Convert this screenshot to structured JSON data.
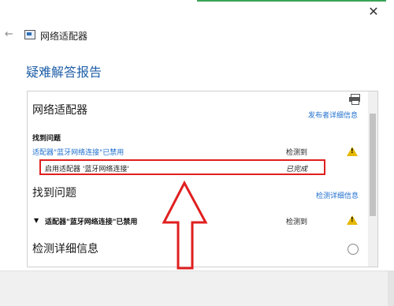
{
  "window": {
    "title": "网络适配器",
    "close_glyph": "✕",
    "back_glyph": "←"
  },
  "page_heading": "疑难解答报告",
  "report": {
    "section1_title": "网络适配器",
    "publisher_link": "发布者详细信息",
    "found_issues_label": "找到问题",
    "issue_link": "适配器\"蓝牙网络连接\"已禁用",
    "issue_status": "检测到",
    "action_text": "启用适配器 '蓝牙网络连接'",
    "action_status": "已完成",
    "section2_title": "找到问题",
    "detection_link": "检测详细信息",
    "collapsed_issue": "适配器\"蓝牙网络连接\"已禁用",
    "collapsed_status": "检测到",
    "section3_title": "检测详细信息"
  },
  "colors": {
    "accent_link": "#1f6fcf",
    "heading": "#1f5fa8",
    "highlight_box": "#e01f1f",
    "warning": "#e6b800",
    "top_accent": "#3aa457"
  },
  "icons": [
    "back-arrow-icon",
    "network-adapter-icon",
    "close-icon",
    "printer-icon",
    "warning-icon",
    "collapse-triangle-icon",
    "expand-circle-icon",
    "up-arrow-annotation"
  ]
}
